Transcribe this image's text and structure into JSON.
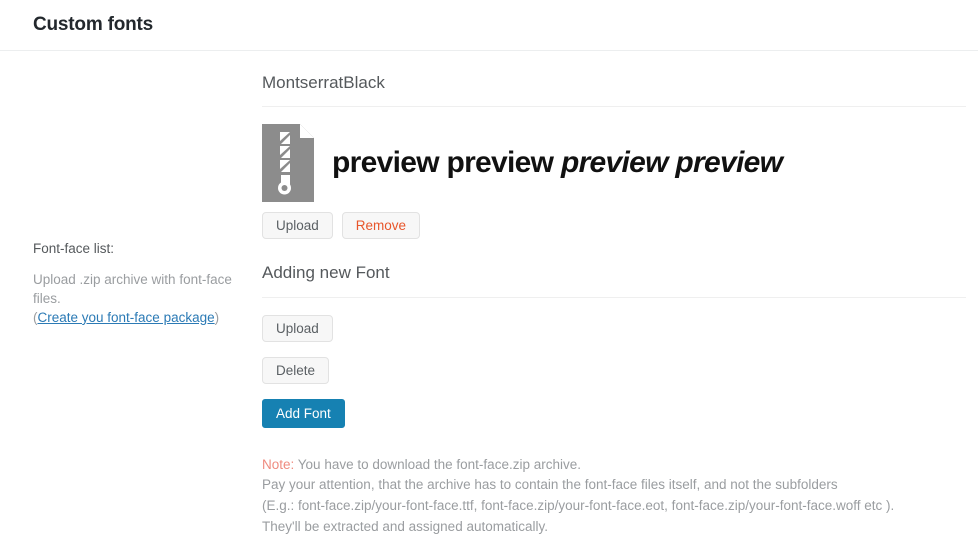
{
  "header": {
    "title": "Custom fonts"
  },
  "sidebar": {
    "label": "Font-face list:",
    "help_before": "Upload .zip archive with font-face files.",
    "help_paren_open": "(",
    "help_link": "Create you font-face package",
    "help_paren_close": ")"
  },
  "font_item": {
    "name": "MontserratBlack",
    "icon": "zip-file-icon",
    "preview_regular": "preview preview",
    "preview_italic": "preview preview",
    "upload_label": "Upload",
    "remove_label": "Remove"
  },
  "add_section": {
    "heading": "Adding new Font",
    "upload_label": "Upload",
    "delete_label": "Delete",
    "add_font_label": "Add Font"
  },
  "note": {
    "label": "Note:",
    "line1": " You have to download the font-face.zip archive.",
    "line2": "Pay your attention, that the archive has to contain the font-face files itself, and not the subfolders",
    "line3": "(E.g.: font-face.zip/your-font-face.ttf, font-face.zip/your-font-face.eot, font-face.zip/your-font-face.woff etc ).",
    "line4": "They'll be extracted and assigned automatically."
  },
  "colors": {
    "primary": "#1681b2",
    "danger": "#e8562b",
    "note": "#ef8b7f",
    "link": "#2b7ab5",
    "icon_gray": "#8c8c8c"
  }
}
